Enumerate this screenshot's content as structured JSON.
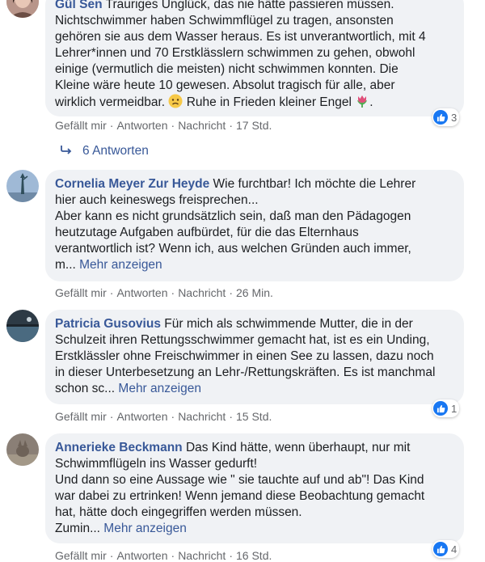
{
  "colors": {
    "link": "#385898",
    "bubble_bg": "#f0f2f5",
    "meta": "#65676b",
    "like": "#1877f2"
  },
  "actions_labels": {
    "like": "Gefällt mir",
    "reply": "Antworten",
    "message": "Nachricht",
    "sep": "·"
  },
  "comments": [
    {
      "author": "Gül Sen",
      "lines": [
        "Trauriges Unglück, das nie hätte passieren müssen.",
        "Nichtschwimmer haben Schwimmflügel zu tragen, ansonsten",
        "gehören sie aus dem Wasser heraus. Es ist unverantwortlich, mit 4",
        "Lehrer*innen und 70 Erstklässlern schwimmen zu gehen, obwohl",
        "einige (vermutlich die meisten) nicht schwimmen konnten. Die",
        "Kleine wäre heute 10 gewesen. Absolut tragisch für alle, aber",
        "wirklich vermeidbar.",
        " Ruhe in Frieden kleiner Engel ",
        "."
      ],
      "time": "17 Std.",
      "reactions": "3",
      "emoji_sad": "sad-face-emoji",
      "emoji_flower": "tulip-emoji"
    },
    {
      "author": "Cornelia Meyer Zur Heyde",
      "lines": [
        "Wie furchtbar! Ich möchte die Lehrer",
        "hier auch keineswegs freisprechen...",
        "Aber kann es nicht grundsätzlich sein, daß man den Pädagogen",
        "heutzutage Aufgaben aufbürdet, für die das Elternhaus",
        "verantwortlich ist? Wenn ich, aus welchen Gründen auch immer,",
        "m... "
      ],
      "more": "Mehr anzeigen",
      "time": "26 Min."
    },
    {
      "author": "Patricia Gusovius",
      "lines": [
        "Für mich als schwimmende Mutter, die in der",
        "Schulzeit ihren Rettungsschwimmer gemacht hat, ist es ein Unding,",
        "Erstklässler ohne Freischwimmer in einen See zu lassen, dazu noch",
        "in dieser Unterbesetzung an Lehr-/Rettungskräften. Es ist manchmal",
        "schon sc... "
      ],
      "more": "Mehr anzeigen",
      "time": "15 Std.",
      "reactions": "1"
    },
    {
      "author": "Annerieke Beckmann",
      "lines": [
        "Das Kind hätte, wenn überhaupt, nur mit",
        "Schwimmflügeln ins Wasser gedurft!",
        "Und dann so eine Aussage wie \" sie tauchte auf und ab\"! Das Kind",
        "war dabei zu ertrinken! Wenn jemand diese Beobachtung gemacht",
        "hat, hätte doch eingegriffen werden müssen.",
        "Zumin... "
      ],
      "more": "Mehr anzeigen",
      "time": "16 Std.",
      "reactions": "4"
    }
  ],
  "replies_link": "6 Antworten"
}
